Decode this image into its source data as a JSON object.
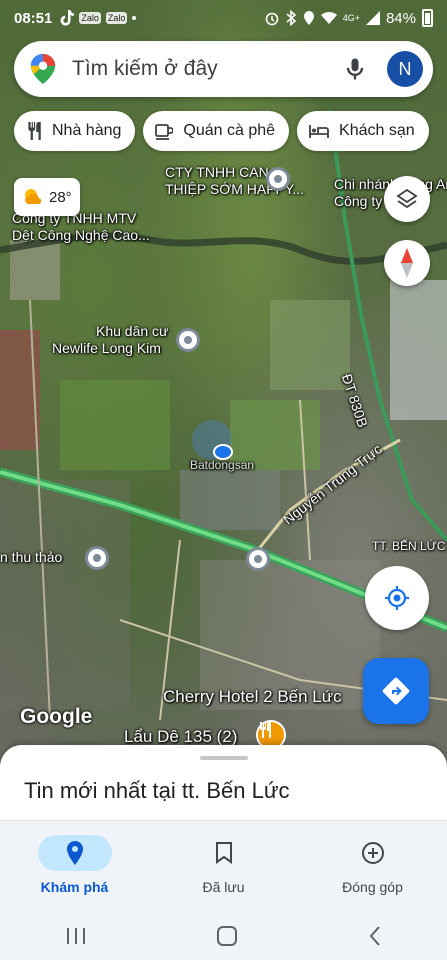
{
  "status_bar": {
    "time": "08:51",
    "left_icons": [
      "tiktok-icon",
      "Zalo",
      "Zalo"
    ],
    "network": "4G+",
    "battery": "84%"
  },
  "search": {
    "placeholder": "Tìm kiếm ở đây",
    "avatar_letter": "N"
  },
  "chips": [
    {
      "label": "Nhà hàng",
      "icon": "restaurant-icon"
    },
    {
      "label": "Quán cà phê",
      "icon": "coffee-icon"
    },
    {
      "label": "Khách sạn",
      "icon": "hotel-icon"
    }
  ],
  "weather": {
    "temp": "28°"
  },
  "map_labels": {
    "company1_l1": "CTY TNHH CAN",
    "company1_l2": "THIỆP SỚM HAPPY...",
    "company2_l1": "Chi nhánh Long An",
    "company2_l2": "Công ty TNHH",
    "company3_l1": "Công ty TNHH MTV",
    "company3_l2": "Dệt Công Nghệ Cao...",
    "residential_l1": "Khu dân cư",
    "residential_l2": "Newlife Long Kim",
    "road_dt830b": "ĐT 830B",
    "road_nguyen": "Nguyễn Trung Trực",
    "town": "TT. BẾN LỨC",
    "place_thuthao": "n thu thảo",
    "hotel": "Cherry Hotel 2 Bến Lức",
    "restaurant": "Lẩu Dê 135 (2)",
    "watermark": "Batdongsan",
    "google": "Google"
  },
  "sheet": {
    "title": "Tin mới nhất tại tt. Bến Lức"
  },
  "nav": [
    {
      "label": "Khám phá",
      "icon": "explore-pin-icon",
      "active": true
    },
    {
      "label": "Đã lưu",
      "icon": "bookmark-icon",
      "active": false
    },
    {
      "label": "Đóng góp",
      "icon": "add-circle-icon",
      "active": false
    }
  ],
  "colors": {
    "accent": "#1a73e8",
    "active_nav_bg": "#c2e7ff",
    "highway": "#4fbf6a"
  }
}
